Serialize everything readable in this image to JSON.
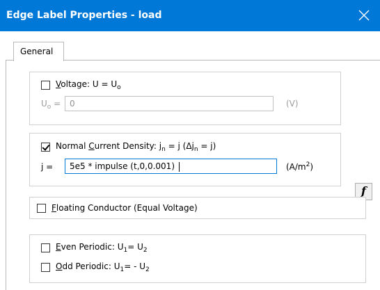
{
  "window": {
    "title": "Edge Label Properties - load"
  },
  "tabs": [
    {
      "label": "General"
    }
  ],
  "voltage": {
    "checked": false,
    "label_u": "V",
    "label_rest": "oltage: U = U",
    "sub": "o",
    "field_label": "U",
    "field_sub": "o",
    "field_eq": "=",
    "value": "0",
    "unit": "(V)"
  },
  "current": {
    "checked": true,
    "label_pre": "Normal ",
    "label_u": "C",
    "label_rest": "urrent Density: j",
    "sub_n": "n",
    "label_mid": "= j (Δj",
    "sub_n2": "n",
    "label_end": "= j)",
    "field_label": "j =",
    "value": "5e5 * impulse (t,0,0.001)",
    "unit_pre": "(A/m",
    "unit_sup": "2",
    "unit_post": ")"
  },
  "floating": {
    "checked": false,
    "label_u": "F",
    "label_rest": "loating Conductor  (Equal Voltage)"
  },
  "even": {
    "checked": false,
    "label_u": "E",
    "label_rest": "ven Periodic: U",
    "sub1": "1",
    "eq": "= U",
    "sub2": "2"
  },
  "odd": {
    "checked": false,
    "label_u": "O",
    "label_rest": "dd Periodic: U",
    "sub1": "1",
    "eq": "= - U",
    "sub2": "2"
  },
  "function_button": {
    "label": "f"
  }
}
